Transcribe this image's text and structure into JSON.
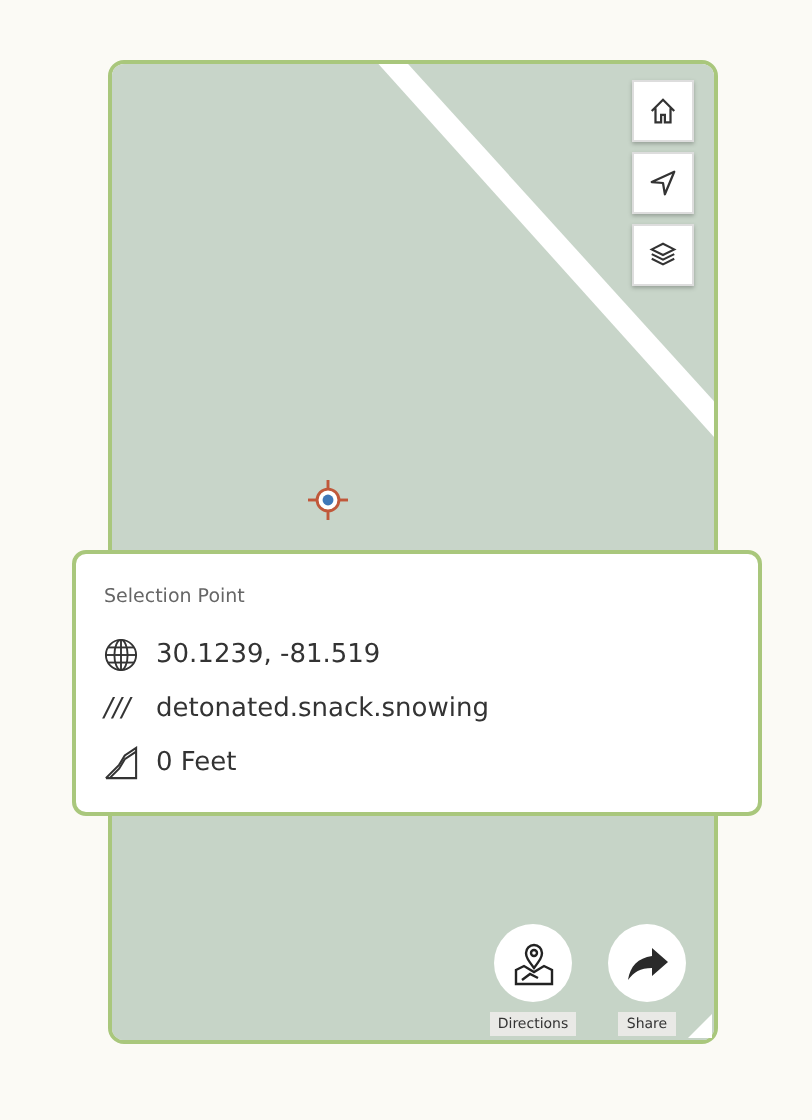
{
  "map_controls": [
    {
      "kind": "home"
    },
    {
      "kind": "locate"
    },
    {
      "kind": "layers"
    }
  ],
  "selection": {
    "title": "Selection Point",
    "rows": [
      {
        "kind": "globe",
        "text": "30.1239, -81.519"
      },
      {
        "kind": "words",
        "prefix": "///",
        "text": "detonated.snack.snowing"
      },
      {
        "kind": "elevation",
        "text": "0 Feet"
      }
    ]
  },
  "actions": [
    {
      "kind": "directions",
      "label": "Directions"
    },
    {
      "kind": "share",
      "label": "Share"
    }
  ]
}
